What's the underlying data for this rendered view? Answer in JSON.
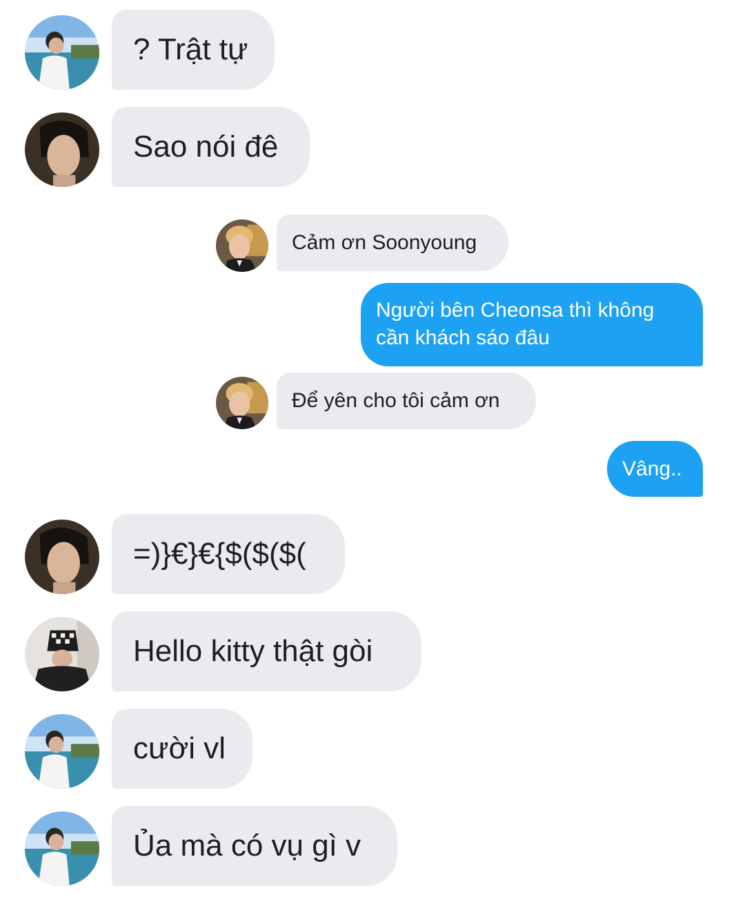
{
  "colors": {
    "incoming_bubble": "#e9ebee",
    "outgoing_bubble": "#1da1f2",
    "incoming_text": "#1c1e21",
    "outgoing_text": "#ffffff"
  },
  "messages": [
    {
      "sender_avatar": "avatar-boy-sea-photo",
      "text": "? Trật tự"
    },
    {
      "sender_avatar": "avatar-boy-side-profile",
      "text": "Sao nói đê"
    },
    {
      "sender_avatar": "avatar-blond-suit",
      "text": "Cảm ơn Soonyoung"
    },
    {
      "sender_avatar": null,
      "text": "Người bên Cheonsa thì không cần khách sáo đâu"
    },
    {
      "sender_avatar": "avatar-blond-suit",
      "text": "Để yên cho tôi cảm ơn"
    },
    {
      "sender_avatar": null,
      "text": "Vâng.."
    },
    {
      "sender_avatar": "avatar-boy-side-profile",
      "text": "=)}€}€{$($($("
    },
    {
      "sender_avatar": "avatar-checkered-hat",
      "text": "Hello kitty thật gòi"
    },
    {
      "sender_avatar": "avatar-boy-sea-photo",
      "text": "cười vl"
    },
    {
      "sender_avatar": "avatar-boy-sea-photo",
      "text": "Ủa mà có vụ gì v"
    }
  ]
}
